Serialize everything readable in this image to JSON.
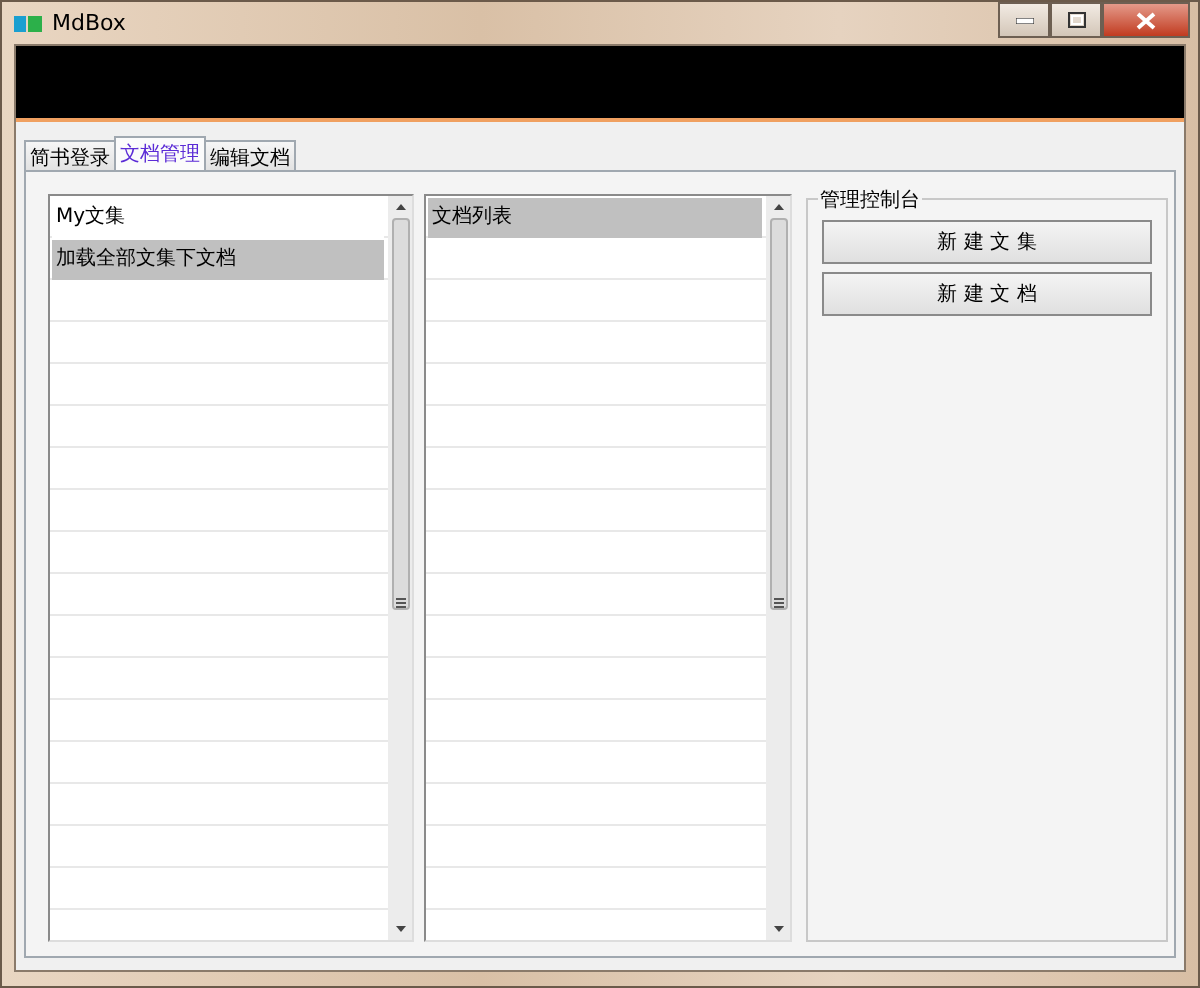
{
  "window": {
    "title": "MdBox"
  },
  "tabs": [
    {
      "label": "简书登录",
      "selected": false
    },
    {
      "label": "文档管理",
      "selected": true
    },
    {
      "label": "编辑文档",
      "selected": false
    }
  ],
  "collections": {
    "items": [
      {
        "label": "My文集",
        "selected": false
      },
      {
        "label": "加载全部文集下文档",
        "selected": true
      }
    ]
  },
  "documents": {
    "items": [
      {
        "label": "文档列表",
        "selected": true
      }
    ]
  },
  "control_panel": {
    "title": "管理控制台",
    "buttons": [
      "新 建 文 集",
      "新 建 文 档"
    ]
  }
}
